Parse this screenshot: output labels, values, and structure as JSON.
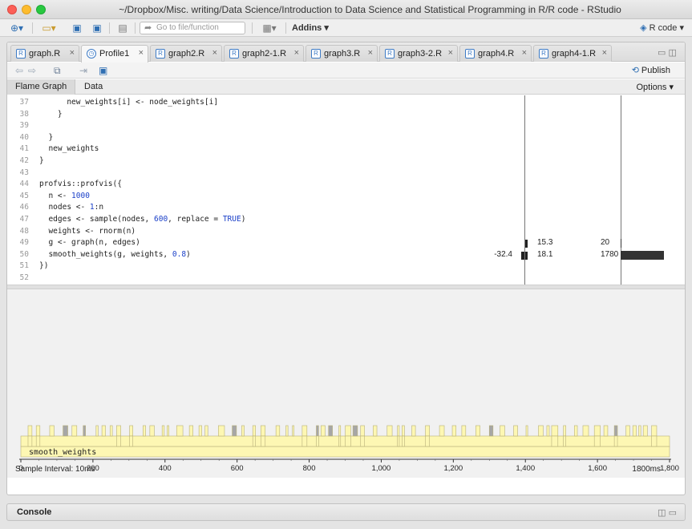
{
  "window": {
    "title": "~/Dropbox/Misc. writing/Data Science/Introduction to Data Science and Statistical Programming in R/R code - RStudio"
  },
  "toolbar": {
    "goto_placeholder": "Go to file/function",
    "addins_label": "Addins",
    "project_label": "R code"
  },
  "tabs": [
    {
      "label": "graph.R",
      "active": false
    },
    {
      "label": "Profile1",
      "active": true
    },
    {
      "label": "graph2.R",
      "active": false
    },
    {
      "label": "graph2-1.R",
      "active": false
    },
    {
      "label": "graph3.R",
      "active": false
    },
    {
      "label": "graph3-2.R",
      "active": false
    },
    {
      "label": "graph4.R",
      "active": false
    },
    {
      "label": "graph4-1.R",
      "active": false
    }
  ],
  "subtoolbar": {
    "publish_label": "Publish"
  },
  "view_tabs": {
    "flame_label": "Flame Graph",
    "data_label": "Data",
    "options_label": "Options"
  },
  "code_lines": [
    {
      "n": "37",
      "text": "      new_weights[i] <- node_weights[i]"
    },
    {
      "n": "38",
      "text": "    }"
    },
    {
      "n": "39",
      "text": ""
    },
    {
      "n": "40",
      "text": "  }"
    },
    {
      "n": "41",
      "text": "  new_weights"
    },
    {
      "n": "42",
      "text": "}"
    },
    {
      "n": "43",
      "text": ""
    },
    {
      "n": "44",
      "text": "profvis::profvis({"
    },
    {
      "n": "45",
      "text": "  n <- 1000"
    },
    {
      "n": "46",
      "text": "  nodes <- 1:n"
    },
    {
      "n": "47",
      "text": "  edges <- sample(nodes, 600, replace = TRUE)"
    },
    {
      "n": "48",
      "text": "  weights <- rnorm(n)"
    },
    {
      "n": "49",
      "text": "  g <- graph(n, edges)"
    },
    {
      "n": "50",
      "text": "  smooth_weights(g, weights, 0.8)"
    },
    {
      "n": "51",
      "text": "})"
    },
    {
      "n": "52",
      "text": ""
    }
  ],
  "profile_stats": {
    "line49": {
      "mem_pos": "15.3",
      "time": "20"
    },
    "line50": {
      "mem_neg": "-32.4",
      "mem_pos": "18.1",
      "time": "1780"
    }
  },
  "flame_graph": {
    "root_label": "smooth_weights",
    "axis_ticks": [
      "0",
      "200",
      "400",
      "600",
      "800",
      "1,000",
      "1,200",
      "1,400",
      "1,600",
      "1,800"
    ],
    "sample_interval": "Sample Interval: 10ms",
    "total_time": "1800ms",
    "colors": {
      "bar": "#fdf7b3",
      "border": "#b8b07a",
      "sel": "#a6a6a6"
    }
  },
  "console": {
    "label": "Console"
  }
}
